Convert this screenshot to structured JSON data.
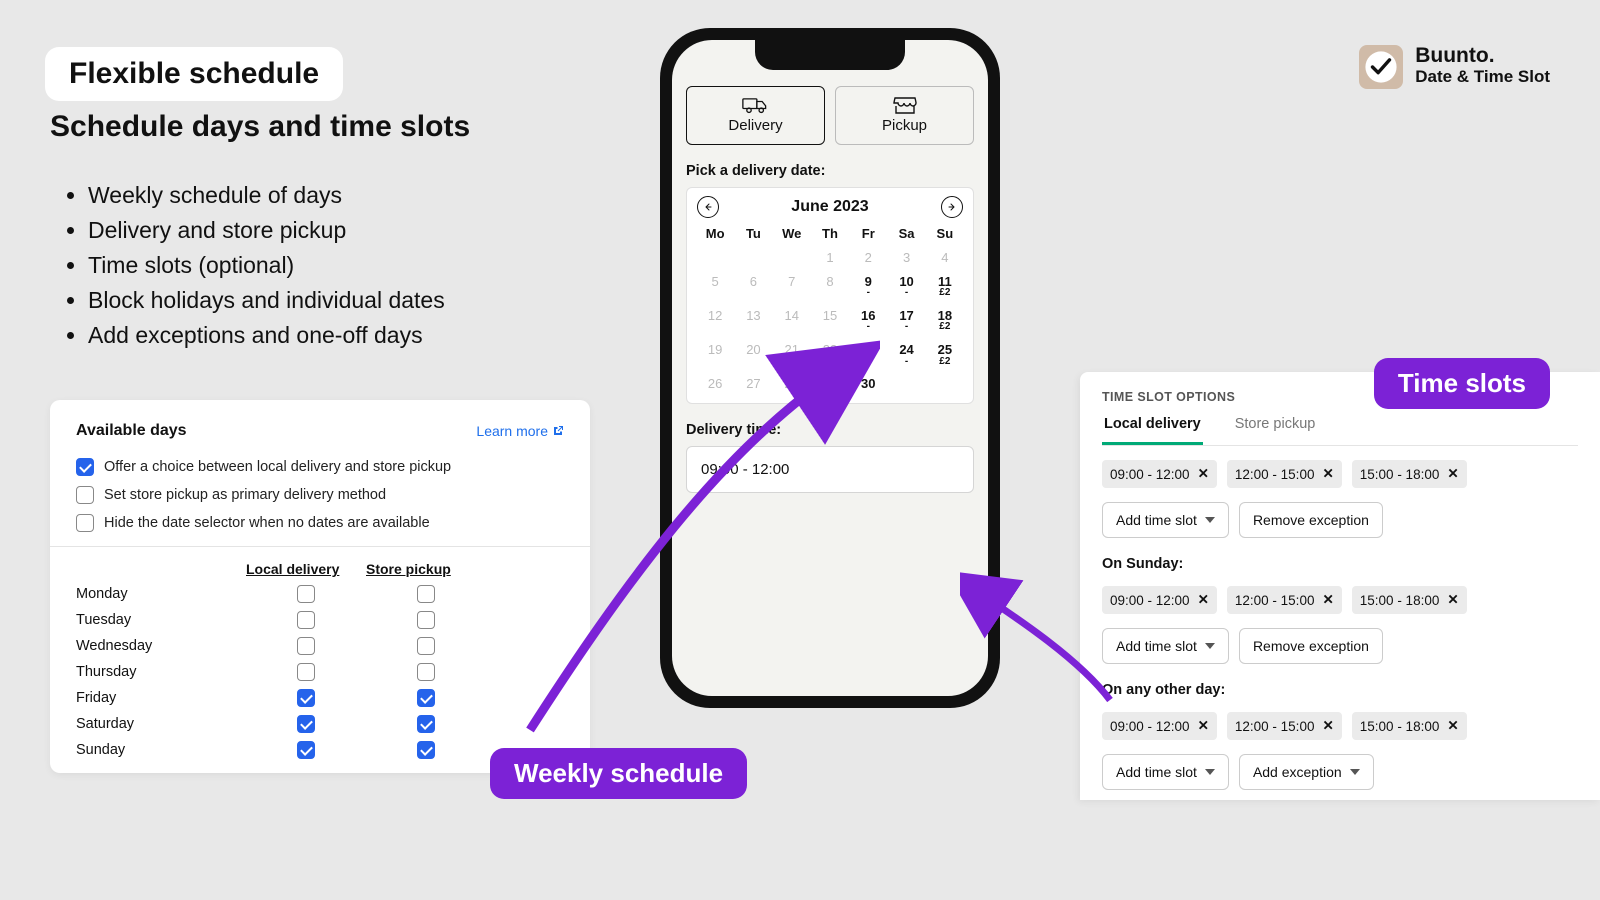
{
  "header": {
    "title_pill": "Flexible schedule",
    "subtitle": "Schedule days and time slots",
    "bullets": [
      "Weekly schedule of days",
      "Delivery and store pickup",
      "Time slots (optional)",
      "Block holidays and individual dates",
      "Add exceptions and one-off days"
    ]
  },
  "brand": {
    "name": "Buunto",
    "tagline": "Date & Time Slot"
  },
  "available_days": {
    "title": "Available days",
    "learn_more": "Learn more",
    "options": {
      "offer_choice": {
        "label": "Offer a choice between local delivery and store pickup",
        "checked": true
      },
      "primary_pickup": {
        "label": "Set store pickup as primary delivery method",
        "checked": false
      },
      "hide_selector": {
        "label": "Hide the date selector when no dates are available",
        "checked": false
      }
    },
    "col_local": "Local delivery",
    "col_pickup": "Store pickup",
    "rows": [
      {
        "day": "Monday",
        "local": false,
        "pickup": false
      },
      {
        "day": "Tuesday",
        "local": false,
        "pickup": false
      },
      {
        "day": "Wednesday",
        "local": false,
        "pickup": false
      },
      {
        "day": "Thursday",
        "local": false,
        "pickup": false
      },
      {
        "day": "Friday",
        "local": true,
        "pickup": true
      },
      {
        "day": "Saturday",
        "local": true,
        "pickup": true
      },
      {
        "day": "Sunday",
        "local": true,
        "pickup": true
      }
    ]
  },
  "phone": {
    "mode_delivery": "Delivery",
    "mode_pickup": "Pickup",
    "pick_date_label": "Pick a delivery date:",
    "month": "June 2023",
    "dow": [
      "Mo",
      "Tu",
      "We",
      "Th",
      "Fr",
      "Sa",
      "Su"
    ],
    "weeks": [
      [
        {
          "n": "",
          "on": false
        },
        {
          "n": "",
          "on": false
        },
        {
          "n": "",
          "on": false
        },
        {
          "n": "1",
          "on": false
        },
        {
          "n": "2",
          "on": false
        },
        {
          "n": "3",
          "on": false
        },
        {
          "n": "4",
          "on": false
        }
      ],
      [
        {
          "n": "5",
          "on": false
        },
        {
          "n": "6",
          "on": false
        },
        {
          "n": "7",
          "on": false
        },
        {
          "n": "8",
          "on": false
        },
        {
          "n": "9",
          "on": true,
          "sub": "-"
        },
        {
          "n": "10",
          "on": true,
          "sub": "-"
        },
        {
          "n": "11",
          "on": true,
          "sub": "£2"
        }
      ],
      [
        {
          "n": "12",
          "on": false
        },
        {
          "n": "13",
          "on": false
        },
        {
          "n": "14",
          "on": false
        },
        {
          "n": "15",
          "on": false
        },
        {
          "n": "16",
          "on": true,
          "sub": "-"
        },
        {
          "n": "17",
          "on": true,
          "sub": "-"
        },
        {
          "n": "18",
          "on": true,
          "sub": "£2"
        }
      ],
      [
        {
          "n": "19",
          "on": false
        },
        {
          "n": "20",
          "on": false
        },
        {
          "n": "21",
          "on": false
        },
        {
          "n": "22",
          "on": false
        },
        {
          "n": "23",
          "on": true,
          "sub": "-"
        },
        {
          "n": "24",
          "on": true,
          "sub": "-"
        },
        {
          "n": "25",
          "on": true,
          "sub": "£2"
        }
      ],
      [
        {
          "n": "26",
          "on": false
        },
        {
          "n": "27",
          "on": false
        },
        {
          "n": "28",
          "on": false
        },
        {
          "n": "29",
          "on": false
        },
        {
          "n": "30",
          "on": true
        },
        {
          "n": "",
          "on": false
        },
        {
          "n": "",
          "on": false
        }
      ]
    ],
    "delivery_time_label": "Delivery time:",
    "delivery_time_value": "09:00 - 12:00"
  },
  "time_slots": {
    "heading": "TIME SLOT OPTIONS",
    "tab_local": "Local delivery",
    "tab_pickup": "Store pickup",
    "sections": [
      {
        "label": "",
        "chips": [
          "09:00 - 12:00",
          "12:00 - 15:00",
          "15:00 - 18:00"
        ],
        "add": "Add time slot",
        "second": "Remove exception"
      },
      {
        "label": "On Sunday:",
        "chips": [
          "09:00 - 12:00",
          "12:00 - 15:00",
          "15:00 - 18:00"
        ],
        "add": "Add time slot",
        "second": "Remove exception"
      },
      {
        "label": "On any other day:",
        "chips": [
          "09:00 - 12:00",
          "12:00 - 15:00",
          "15:00 - 18:00"
        ],
        "add": "Add time slot",
        "second": "Add exception"
      }
    ]
  },
  "pills": {
    "weekly": "Weekly schedule",
    "timeslots": "Time slots"
  }
}
